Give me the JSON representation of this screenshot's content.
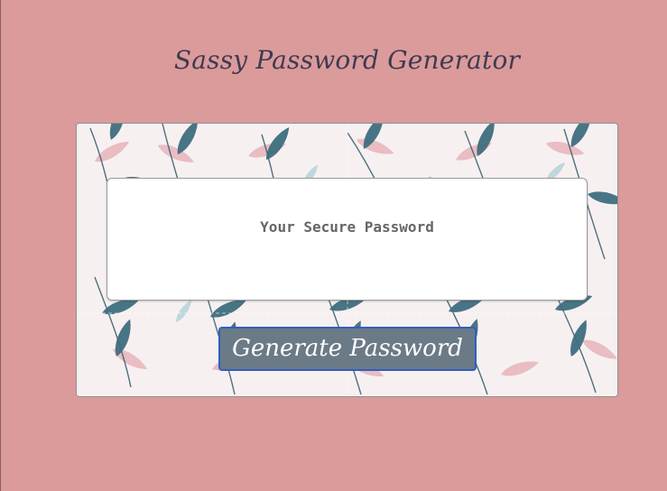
{
  "app": {
    "title": "Sassy Password Generator"
  },
  "password": {
    "placeholder": "Your Secure Password"
  },
  "actions": {
    "generate_label": "Generate Password"
  },
  "colors": {
    "background": "#db9b9b",
    "title": "#3f3a52",
    "button": "#6b7a87",
    "button_border": "#2f5fbf",
    "leaf_teal": "#3f6e7f",
    "leaf_pink": "#e7b7bd"
  }
}
